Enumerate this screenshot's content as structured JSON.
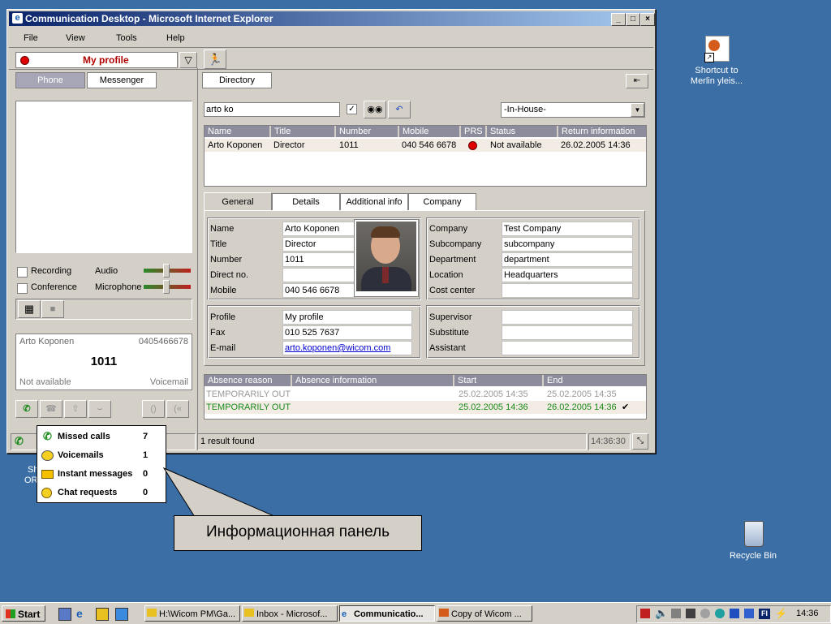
{
  "window": {
    "title": "Communication Desktop - Microsoft Internet Explorer"
  },
  "menu": [
    "File",
    "View",
    "Tools",
    "Help"
  ],
  "left": {
    "profile_label": "My profile",
    "tabs": [
      "Phone",
      "Messenger"
    ],
    "recording_label": "Recording",
    "conference_label": "Conference",
    "audio_label": "Audio",
    "microphone_label": "Microphone",
    "call": {
      "name": "Arto Koponen",
      "number_right": "0405466678",
      "extension": "1011",
      "status": "Not available",
      "voicemail": "Voicemail"
    }
  },
  "right": {
    "tab_directory": "Directory",
    "search_value": "arto ko",
    "location_select": "-In-House-",
    "results": {
      "columns": [
        "Name",
        "Title",
        "Number",
        "Mobile",
        "PRS",
        "Status",
        "Return information"
      ],
      "rows": [
        [
          "Arto Koponen",
          "Director",
          "1011",
          "040 546 6678",
          "",
          "Not available",
          "26.02.2005 14:36"
        ]
      ]
    },
    "detail_tabs": [
      "General",
      "Details",
      "Additional info",
      "Company"
    ],
    "person": {
      "labels": [
        "Name",
        "Title",
        "Number",
        "Direct no.",
        "Mobile"
      ],
      "values": [
        "Arto Koponen",
        "Director",
        "1011",
        "",
        "040 546 6678"
      ]
    },
    "company": {
      "labels": [
        "Company",
        "Subcompany",
        "Department",
        "Location",
        "Cost center"
      ],
      "values": [
        "Test Company",
        "subcompany",
        "department",
        "Headquarters",
        ""
      ]
    },
    "profile": {
      "labels": [
        "Profile",
        "Fax",
        "E-mail"
      ],
      "values": [
        "My profile",
        "010 525 7637",
        "arto.koponen@wicom.com"
      ]
    },
    "supervisor": {
      "labels": [
        "Supervisor",
        "Substitute",
        "Assistant"
      ]
    },
    "absence": {
      "columns": [
        "Absence reason",
        "Absence information",
        "Start",
        "End"
      ],
      "rows": [
        [
          "TEMPORARILY OUT",
          "",
          "25.02.2005 14:35",
          "25.02.2005 14:35"
        ],
        [
          "TEMPORARILY OUT",
          "",
          "25.02.2005 14:36",
          "26.02.2005 14:36"
        ]
      ]
    }
  },
  "status_bar": {
    "results": "1 result found",
    "time": "14:36:30"
  },
  "popup": {
    "items": [
      {
        "label": "Missed calls",
        "count": "7"
      },
      {
        "label": "Voicemails",
        "count": "1"
      },
      {
        "label": "Instant messages",
        "count": "0"
      },
      {
        "label": "Chat requests",
        "count": "0"
      }
    ]
  },
  "callout": "Информационная панель",
  "desktop": {
    "shortcut_label_1": "Shortcut to",
    "shortcut_label_2": "Merlin yleis...",
    "recycle_bin": "Recycle Bin",
    "partial_label_1": "Sh",
    "partial_label_2": "OR"
  },
  "taskbar": {
    "start": "Start",
    "tasks": [
      "H:\\Wicom PM\\Ga...",
      "Inbox - Microsof...",
      "Communicatio...",
      "Copy of Wicom ..."
    ],
    "clock": "14:36"
  }
}
